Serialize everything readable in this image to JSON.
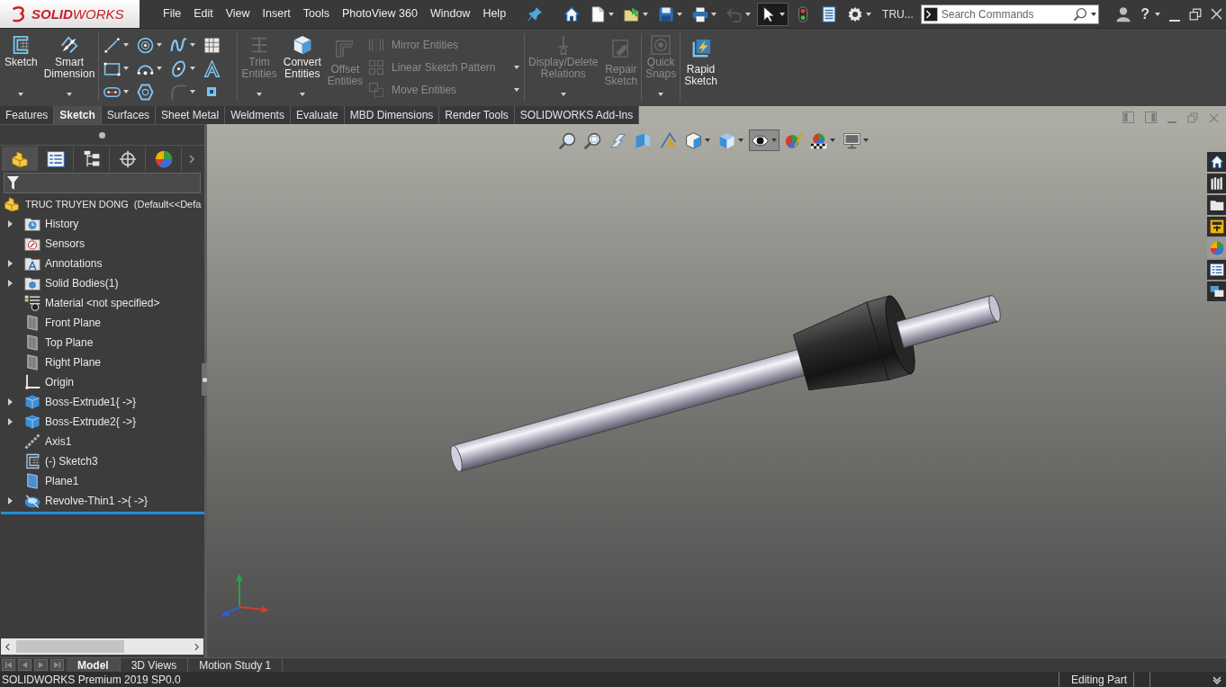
{
  "titlebar": {
    "logo": "**SOLID**WORKS",
    "menu": [
      "File",
      "Edit",
      "View",
      "Insert",
      "Tools",
      "PhotoView 360",
      "Window",
      "Help"
    ],
    "toolbar": [
      {
        "kind": "home",
        "dropdown": false,
        "disabled": false,
        "selected": false
      },
      {
        "kind": "new",
        "dropdown": true,
        "disabled": false,
        "selected": false
      },
      {
        "kind": "open",
        "dropdown": true,
        "disabled": false,
        "selected": false
      },
      {
        "kind": "save",
        "dropdown": true,
        "disabled": false,
        "selected": false
      },
      {
        "kind": "print",
        "dropdown": true,
        "disabled": false,
        "selected": false
      },
      {
        "kind": "undo",
        "dropdown": true,
        "disabled": true,
        "selected": false
      },
      {
        "kind": "select",
        "dropdown": true,
        "disabled": false,
        "selected": true
      },
      {
        "kind": "rebuild",
        "dropdown": false,
        "disabled": false,
        "selected": false
      },
      {
        "kind": "file-properties",
        "dropdown": false,
        "disabled": false,
        "selected": false
      },
      {
        "kind": "options",
        "dropdown": true,
        "disabled": false,
        "selected": false
      }
    ],
    "document": "TRU...",
    "search": {
      "placeholder": "Search Commands"
    },
    "help": "?"
  },
  "ribbon": [
    [
      {
        "kind": "sketch",
        "label": "Sketch",
        "dropdown": true,
        "disabled": false
      },
      {
        "kind": "smart-dimension",
        "label": "Smart Dimension",
        "dropdown": true,
        "disabled": false
      }
    ],
    [
      {
        "grid": [
          {
            "kind": "line",
            "dropdown": true,
            "disabled": false
          },
          {
            "kind": "circle",
            "dropdown": true,
            "disabled": false
          },
          {
            "kind": "spline",
            "dropdown": true,
            "disabled": false
          },
          {
            "kind": "hatch",
            "dropdown": false,
            "disabled": false
          },
          {
            "kind": "rectangle",
            "dropdown": true,
            "disabled": false
          },
          {
            "kind": "arc",
            "dropdown": true,
            "disabled": false
          },
          {
            "kind": "ellipse",
            "dropdown": true,
            "disabled": false
          },
          {
            "kind": "text",
            "dropdown": false,
            "disabled": false
          },
          {
            "kind": "slot",
            "dropdown": true,
            "disabled": false
          },
          {
            "kind": "polygon",
            "dropdown": false,
            "disabled": false
          },
          {
            "kind": "fillet",
            "dropdown": true,
            "disabled": true
          },
          {
            "kind": "point",
            "dropdown": false,
            "disabled": false
          }
        ]
      }
    ],
    [
      {
        "kind": "trim",
        "label": "Trim Entities",
        "dropdown": true,
        "disabled": true
      },
      {
        "kind": "convert",
        "label": "Convert Entities",
        "dropdown": true,
        "disabled": false
      },
      {
        "kind": "offset",
        "label": "Offset Entities",
        "dropdown": false,
        "disabled": true
      },
      {
        "stack": [
          {
            "kind": "mirror",
            "label": "Mirror Entities",
            "dropdown": false,
            "disabled": true
          },
          {
            "kind": "linear-pattern",
            "label": "Linear Sketch Pattern",
            "dropdown": true,
            "disabled": true
          },
          {
            "kind": "move",
            "label": "Move Entities",
            "dropdown": true,
            "disabled": true
          }
        ]
      }
    ],
    [
      {
        "kind": "relations",
        "label": "Display/Delete Relations",
        "dropdown": true,
        "disabled": true
      },
      {
        "kind": "repair",
        "label": "Repair Sketch",
        "dropdown": false,
        "disabled": true
      }
    ],
    [
      {
        "kind": "quick-snaps",
        "label": "Quick Snaps",
        "dropdown": true,
        "disabled": true
      }
    ],
    [
      {
        "kind": "rapid-sketch",
        "label": "Rapid Sketch",
        "dropdown": false,
        "disabled": false
      }
    ]
  ],
  "command_tabs": [
    {
      "label": "Features",
      "selected": false
    },
    {
      "label": "Sketch",
      "selected": true
    },
    {
      "label": "Surfaces",
      "selected": false
    },
    {
      "label": "Sheet Metal",
      "selected": false
    },
    {
      "label": "Weldments",
      "selected": false
    },
    {
      "label": "Evaluate",
      "selected": false
    },
    {
      "label": "MBD Dimensions",
      "selected": false
    },
    {
      "label": "Render Tools",
      "selected": false
    },
    {
      "label": "SOLIDWORKS Add-Ins",
      "selected": false
    }
  ],
  "feature_manager": {
    "tabs": [
      {
        "kind": "feature-tree",
        "selected": true
      },
      {
        "kind": "property-manager",
        "selected": false
      },
      {
        "kind": "configuration-manager",
        "selected": false
      },
      {
        "kind": "dimxpert",
        "selected": false
      },
      {
        "kind": "display-manager",
        "selected": false
      }
    ],
    "root": {
      "kind": "part",
      "label": "TRUC TRUYEN DONG  (Default<<Defa"
    },
    "items": [
      {
        "kind": "history",
        "label": "History",
        "expandable": true
      },
      {
        "kind": "sensors",
        "label": "Sensors",
        "expandable": false
      },
      {
        "kind": "annotations",
        "label": "Annotations",
        "expandable": true
      },
      {
        "kind": "solid-bodies",
        "label": "Solid Bodies(1)",
        "expandable": true
      },
      {
        "kind": "material",
        "label": "Material <not specified>",
        "expandable": false
      },
      {
        "kind": "plane",
        "label": "Front Plane",
        "expandable": false
      },
      {
        "kind": "plane",
        "label": "Top Plane",
        "expandable": false
      },
      {
        "kind": "plane",
        "label": "Right Plane",
        "expandable": false
      },
      {
        "kind": "origin",
        "label": "Origin",
        "expandable": false
      },
      {
        "kind": "boss-extrude",
        "label": "Boss-Extrude1{ ->}",
        "expandable": true
      },
      {
        "kind": "boss-extrude",
        "label": "Boss-Extrude2{ ->}",
        "expandable": true
      },
      {
        "kind": "axis",
        "label": "Axis1",
        "expandable": false
      },
      {
        "kind": "sketch-item",
        "label": "(-) Sketch3",
        "expandable": false
      },
      {
        "kind": "ref-plane",
        "label": "Plane1",
        "expandable": false
      },
      {
        "kind": "revolve",
        "label": "Revolve-Thin1 ->{ ->}",
        "expandable": true
      }
    ]
  },
  "viewport": {
    "heads_up": [
      {
        "kind": "zoom-to-fit",
        "dropdown": false,
        "selected": false
      },
      {
        "kind": "zoom-to-area",
        "dropdown": false,
        "selected": false
      },
      {
        "kind": "previous-view",
        "dropdown": false,
        "selected": false
      },
      {
        "kind": "section-view",
        "dropdown": false,
        "selected": false
      },
      {
        "kind": "dynamic-annotation",
        "dropdown": false,
        "selected": false
      },
      {
        "kind": "view-orientation",
        "dropdown": true,
        "selected": false
      },
      {
        "kind": "display-style",
        "dropdown": true,
        "selected": false
      },
      {
        "kind": "hide-show",
        "dropdown": true,
        "selected": true
      },
      {
        "kind": "edit-appearance",
        "dropdown": false,
        "selected": false
      },
      {
        "kind": "apply-scene",
        "dropdown": true,
        "selected": false
      },
      {
        "kind": "view-settings",
        "dropdown": true,
        "selected": false
      }
    ],
    "task_pane": [
      {
        "kind": "home",
        "selected": false
      },
      {
        "kind": "design-library",
        "selected": false
      },
      {
        "kind": "file-explorer",
        "selected": false
      },
      {
        "kind": "view-palette",
        "selected": false
      },
      {
        "kind": "appearances",
        "selected": true
      },
      {
        "kind": "custom-properties",
        "selected": false
      },
      {
        "kind": "forum",
        "selected": false
      }
    ]
  },
  "document_tabs": [
    {
      "label": "Model",
      "selected": true
    },
    {
      "label": "3D Views",
      "selected": false
    },
    {
      "label": "Motion Study 1",
      "selected": false
    }
  ],
  "status_bar": {
    "product": "SOLIDWORKS Premium 2019 SP0.0",
    "mode": "Editing Part"
  }
}
